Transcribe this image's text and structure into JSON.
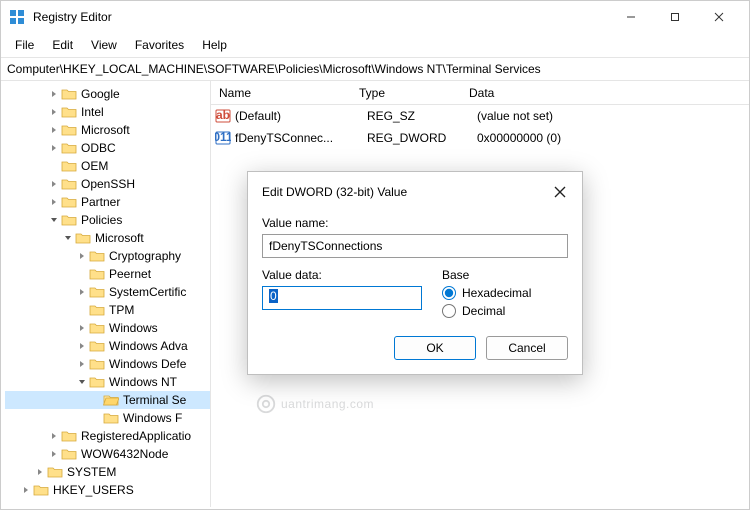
{
  "window": {
    "title": "Registry Editor",
    "minimize": "–",
    "maximize": "▢",
    "close": "✕"
  },
  "menu": {
    "file": "File",
    "edit": "Edit",
    "view": "View",
    "favorites": "Favorites",
    "help": "Help"
  },
  "address": "Computer\\HKEY_LOCAL_MACHINE\\SOFTWARE\\Policies\\Microsoft\\Windows NT\\Terminal Services",
  "tree": [
    {
      "indent": 3,
      "exp": "closed",
      "label": "Google"
    },
    {
      "indent": 3,
      "exp": "closed",
      "label": "Intel"
    },
    {
      "indent": 3,
      "exp": "closed",
      "label": "Microsoft"
    },
    {
      "indent": 3,
      "exp": "closed",
      "label": "ODBC"
    },
    {
      "indent": 3,
      "exp": "none",
      "label": "OEM"
    },
    {
      "indent": 3,
      "exp": "closed",
      "label": "OpenSSH"
    },
    {
      "indent": 3,
      "exp": "closed",
      "label": "Partner"
    },
    {
      "indent": 3,
      "exp": "open",
      "label": "Policies"
    },
    {
      "indent": 4,
      "exp": "open",
      "label": "Microsoft"
    },
    {
      "indent": 5,
      "exp": "closed",
      "label": "Cryptography"
    },
    {
      "indent": 5,
      "exp": "none",
      "label": "Peernet"
    },
    {
      "indent": 5,
      "exp": "closed",
      "label": "SystemCertific"
    },
    {
      "indent": 5,
      "exp": "none",
      "label": "TPM"
    },
    {
      "indent": 5,
      "exp": "closed",
      "label": "Windows"
    },
    {
      "indent": 5,
      "exp": "closed",
      "label": "Windows Adva"
    },
    {
      "indent": 5,
      "exp": "closed",
      "label": "Windows Defe"
    },
    {
      "indent": 5,
      "exp": "open",
      "label": "Windows NT"
    },
    {
      "indent": 6,
      "exp": "none",
      "label": "Terminal Se",
      "selected": true,
      "open": true
    },
    {
      "indent": 6,
      "exp": "none",
      "label": "Windows F"
    },
    {
      "indent": 3,
      "exp": "closed",
      "label": "RegisteredApplicatio"
    },
    {
      "indent": 3,
      "exp": "closed",
      "label": "WOW6432Node"
    },
    {
      "indent": 2,
      "exp": "closed",
      "label": "SYSTEM"
    },
    {
      "indent": 1,
      "exp": "closed",
      "label": "HKEY_USERS"
    }
  ],
  "columns": {
    "name": "Name",
    "type": "Type",
    "data": "Data"
  },
  "values": [
    {
      "icon": "sz",
      "name": "(Default)",
      "type": "REG_SZ",
      "data": "(value not set)"
    },
    {
      "icon": "dw",
      "name": "fDenyTSConnec...",
      "type": "REG_DWORD",
      "data": "0x00000000 (0)"
    }
  ],
  "dialog": {
    "title": "Edit DWORD (32-bit) Value",
    "value_name_label": "Value name:",
    "value_name": "fDenyTSConnections",
    "value_data_label": "Value data:",
    "value_data": "0",
    "base_label": "Base",
    "hex": "Hexadecimal",
    "dec": "Decimal",
    "ok": "OK",
    "cancel": "Cancel"
  },
  "watermark": "uantrimang.com"
}
